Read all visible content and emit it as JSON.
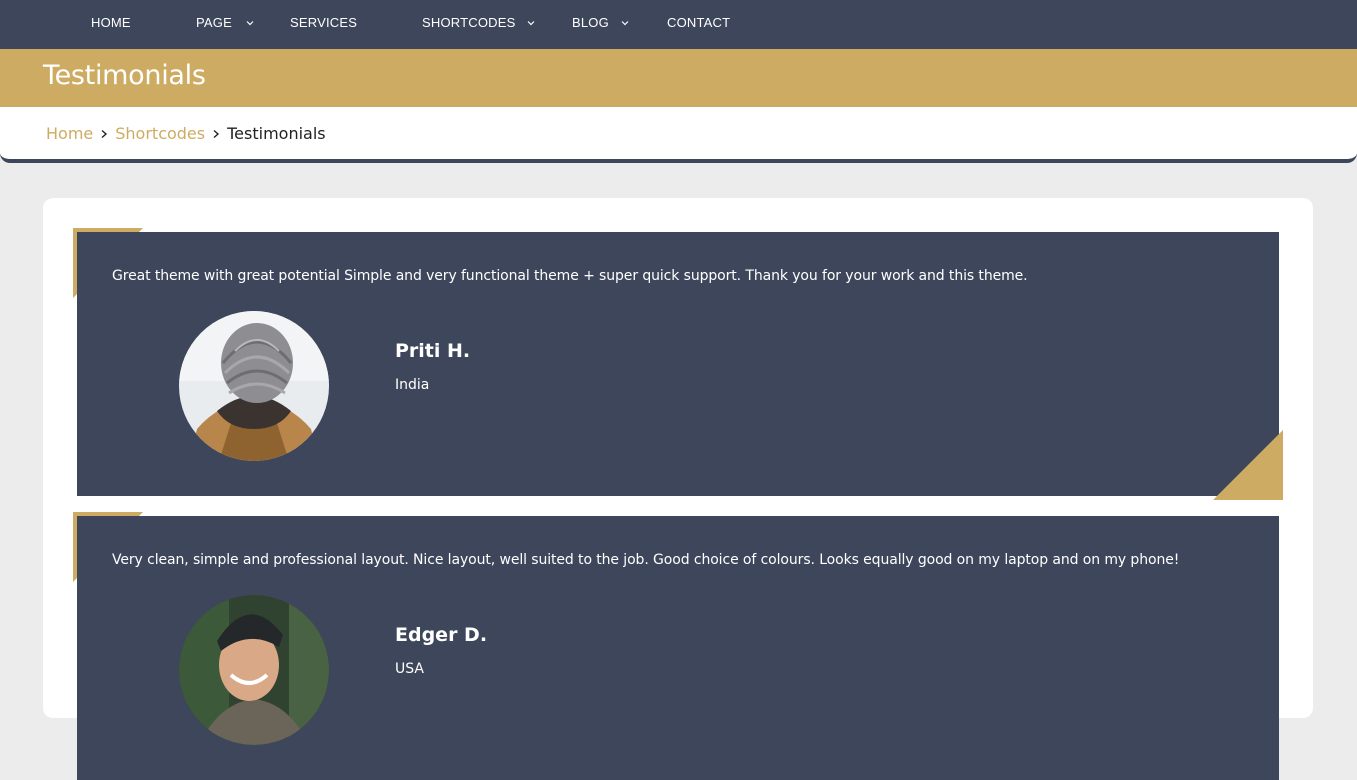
{
  "nav": {
    "items": [
      {
        "label": "HOME",
        "has_dropdown": false
      },
      {
        "label": "PAGE",
        "has_dropdown": true
      },
      {
        "label": "SERVICES",
        "has_dropdown": false
      },
      {
        "label": "SHORTCODES",
        "has_dropdown": true
      },
      {
        "label": "BLOG",
        "has_dropdown": true
      },
      {
        "label": "CONTACT",
        "has_dropdown": false
      }
    ]
  },
  "page": {
    "title": "Testimonials"
  },
  "breadcrumb": {
    "items": [
      "Home",
      "Shortcodes"
    ],
    "current": "Testimonials"
  },
  "testimonials": [
    {
      "quote": "Great theme with great potential Simple and very functional theme + super quick support. Thank you for your work and this theme.",
      "name": "Priti H.",
      "country": "India"
    },
    {
      "quote": "Very clean, simple and professional layout. Nice layout, well suited to the job. Good choice of colours. Looks equally good on my laptop and on my phone!",
      "name": "Edger D.",
      "country": "USA"
    }
  ],
  "colors": {
    "navy": "#3e465b",
    "gold": "#cdab62",
    "page_bg": "#ececec"
  }
}
